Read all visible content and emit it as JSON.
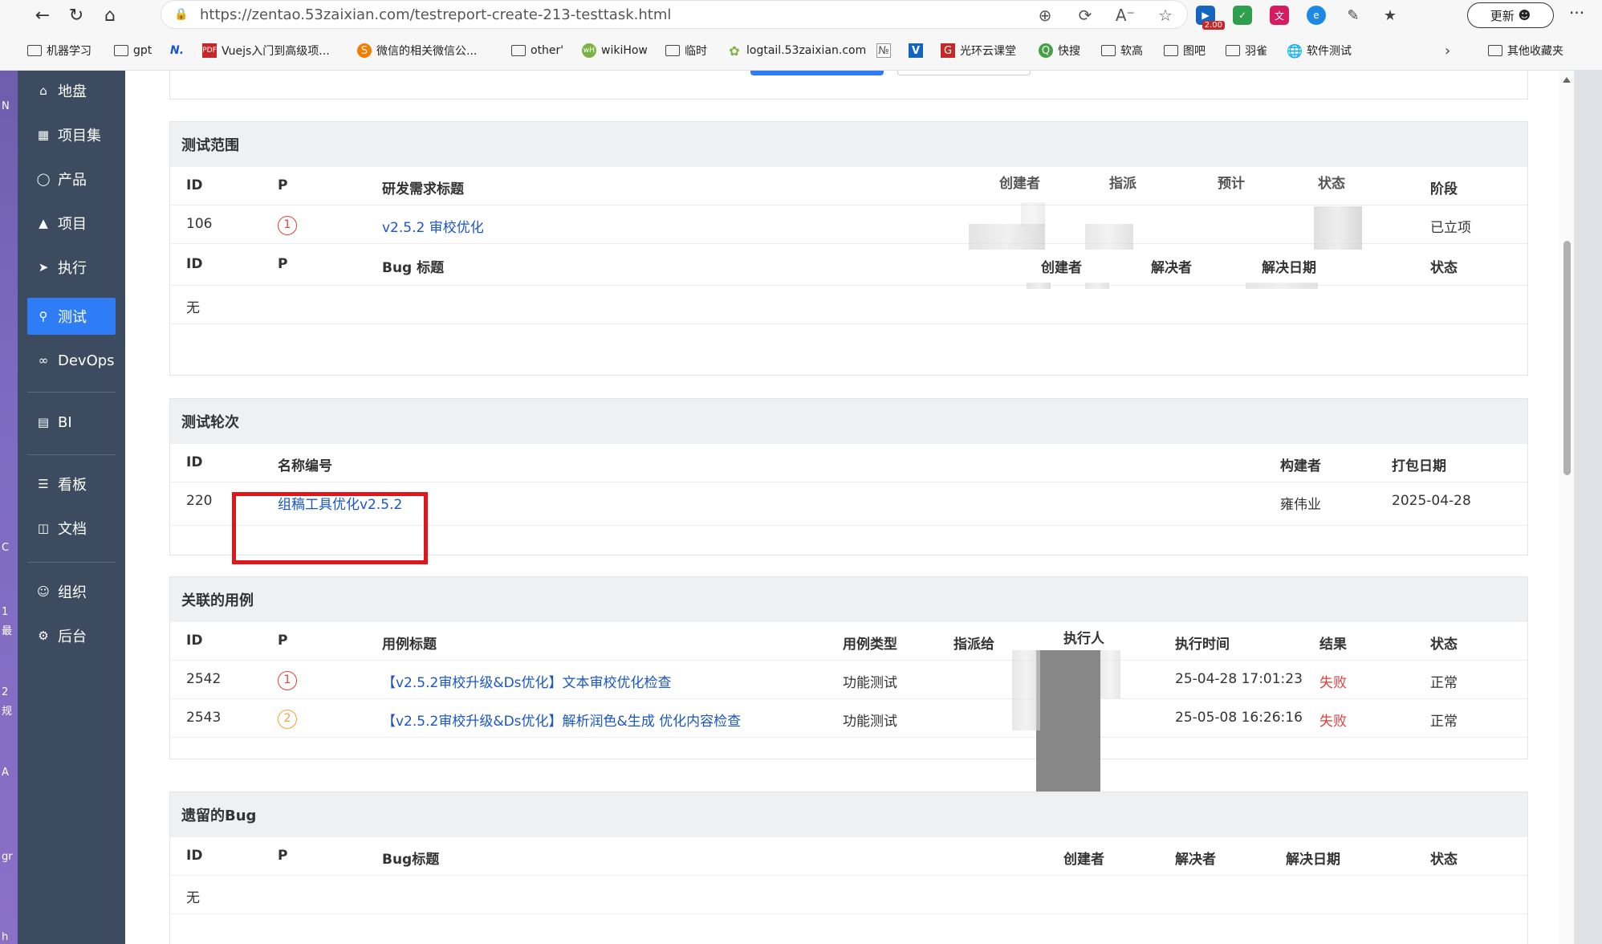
{
  "browser": {
    "url": "https://zentao.53zaixian.com/testreport-create-213-testtask.html",
    "extension_badge": "2.00",
    "update_label": "更新",
    "more_label": "···"
  },
  "bookmarks": [
    {
      "label": "机器学习",
      "icon": "folder-icon"
    },
    {
      "label": "gpt",
      "icon": "folder-icon"
    },
    {
      "label": "",
      "icon": "n-logo-icon"
    },
    {
      "label": "Vuejs入门到高级项...",
      "icon": "pdf-icon"
    },
    {
      "label": "微信的相关微信公...",
      "icon": "s-logo-icon"
    },
    {
      "label": "other'",
      "icon": "folder-icon"
    },
    {
      "label": "wikiHow",
      "icon": "wikihow-icon"
    },
    {
      "label": "临时",
      "icon": "folder-icon"
    },
    {
      "label": "logtail.53zaixian.com",
      "icon": "leaf-icon"
    },
    {
      "label": "",
      "icon": "page-icon"
    },
    {
      "label": "",
      "icon": "v-logo-icon"
    },
    {
      "label": "光环云课堂",
      "icon": "red-logo-icon"
    },
    {
      "label": "快搜",
      "icon": "q-logo-icon"
    },
    {
      "label": "软高",
      "icon": "folder-icon"
    },
    {
      "label": "图吧",
      "icon": "folder-icon"
    },
    {
      "label": "羽雀",
      "icon": "folder-icon"
    },
    {
      "label": "软件测试",
      "icon": "globe-icon"
    },
    {
      "label": "其他收藏夹",
      "icon": "folder-icon"
    }
  ],
  "sidebar": {
    "items": [
      {
        "label": "地盘",
        "icon": "home-icon"
      },
      {
        "label": "项目集",
        "icon": "grid-icon"
      },
      {
        "label": "产品",
        "icon": "bulb-icon"
      },
      {
        "label": "项目",
        "icon": "rocket-icon"
      },
      {
        "label": "执行",
        "icon": "run-icon"
      },
      {
        "label": "测试",
        "icon": "search-icon"
      },
      {
        "label": "DevOps",
        "icon": "infinity-icon"
      },
      {
        "label": "BI",
        "icon": "chart-icon"
      },
      {
        "label": "看板",
        "icon": "board-icon"
      },
      {
        "label": "文档",
        "icon": "doc-icon"
      },
      {
        "label": "组织",
        "icon": "people-icon"
      },
      {
        "label": "后台",
        "icon": "gear-icon"
      }
    ]
  },
  "desktop_strip": [
    "N",
    "C",
    "1",
    "最",
    "2",
    "规",
    "A",
    "gr",
    "h"
  ],
  "scope": {
    "title": "测试范围",
    "story_headers": {
      "id": "ID",
      "p": "P",
      "title": "研发需求标题",
      "creator": "创建者",
      "assign": "指派",
      "estimate": "预计",
      "status": "状态",
      "stage": "阶段"
    },
    "stories": [
      {
        "id": "106",
        "pri": "1",
        "title": "v2.5.2 审校优化",
        "stage": "已立项"
      }
    ],
    "bug_headers": {
      "id": "ID",
      "p": "P",
      "title": "Bug 标题",
      "creator": "创建者",
      "resolver": "解决者",
      "resolved_date": "解决日期",
      "status": "状态"
    },
    "bug_empty": "无"
  },
  "rounds": {
    "title": "测试轮次",
    "headers": {
      "id": "ID",
      "name": "名称编号",
      "builder": "构建者",
      "date": "打包日期"
    },
    "rows": [
      {
        "id": "220",
        "name": "组稿工具优化v2.5.2",
        "builder": "雍伟业",
        "date": "2025-04-28"
      }
    ]
  },
  "cases": {
    "title": "关联的用例",
    "headers": {
      "id": "ID",
      "p": "P",
      "title": "用例标题",
      "type": "用例类型",
      "assign": "指派给",
      "executor": "执行人",
      "exec_time": "执行时间",
      "result": "结果",
      "status": "状态"
    },
    "rows": [
      {
        "id": "2542",
        "pri": "1",
        "title": "【v2.5.2审校升级&Ds优化】文本审校优化检查",
        "type": "功能测试",
        "exec_time": "25-04-28 17:01:23",
        "result": "失败",
        "status": "正常"
      },
      {
        "id": "2543",
        "pri": "2",
        "title": "【v2.5.2审校升级&Ds优化】解析润色&生成 优化内容检查",
        "type": "功能测试",
        "exec_time": "25-05-08 16:26:16",
        "result": "失败",
        "status": "正常"
      }
    ]
  },
  "legacy": {
    "title": "遗留的Bug",
    "headers": {
      "id": "ID",
      "p": "P",
      "title": "Bug标题",
      "creator": "创建者",
      "resolver": "解决者",
      "resolved_date": "解决日期",
      "status": "状态"
    },
    "empty": "无"
  },
  "colors": {
    "sidebar": "#3c4b5f",
    "active": "#2e7df7",
    "link": "#1a56c6",
    "fail": "#e2403a",
    "highlight": "#e0161b"
  }
}
